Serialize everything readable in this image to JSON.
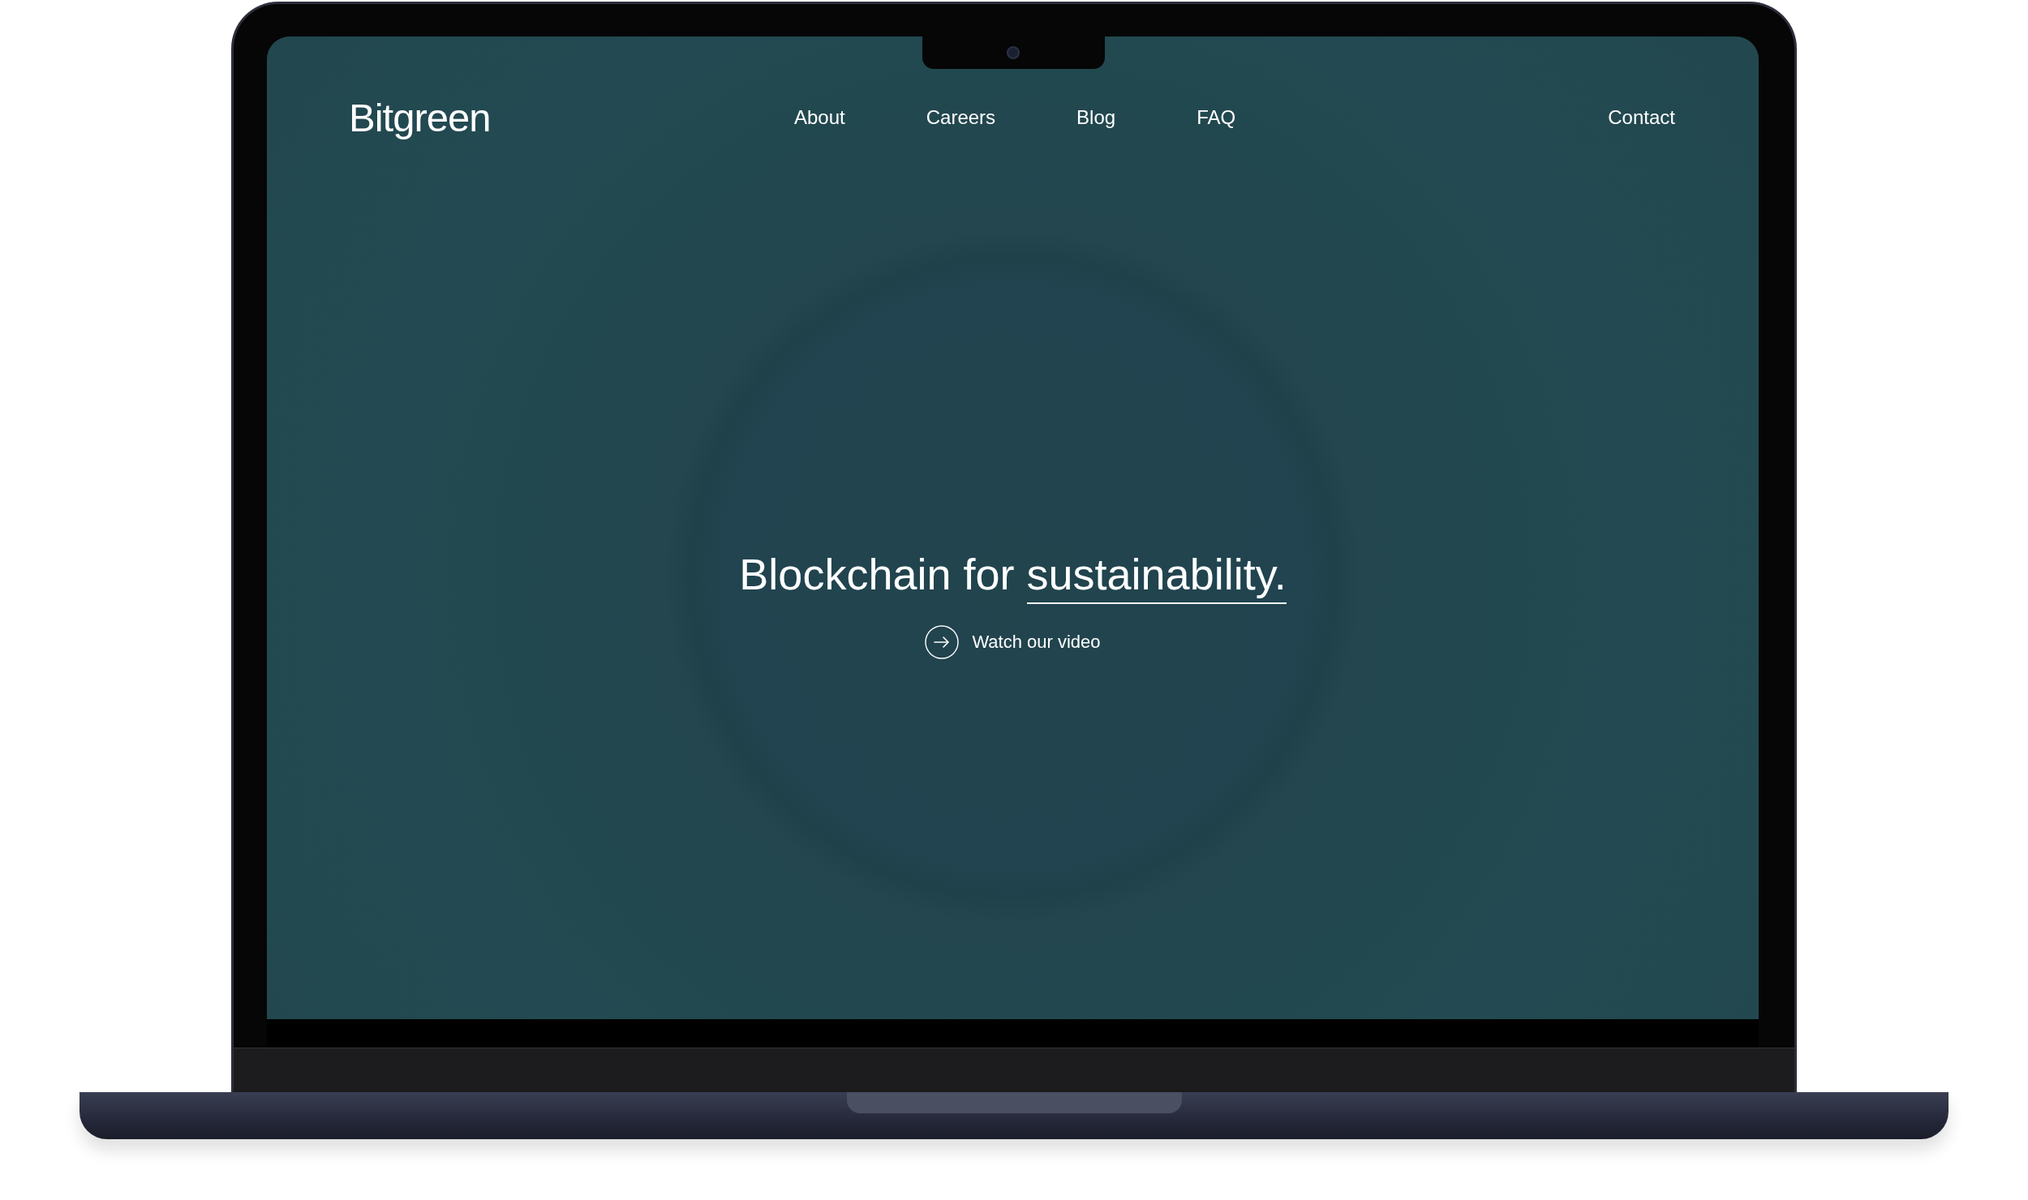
{
  "site": {
    "logo": "Bitgreen",
    "nav": [
      {
        "label": "About"
      },
      {
        "label": "Careers"
      },
      {
        "label": "Blog"
      },
      {
        "label": "FAQ"
      }
    ],
    "contact": "Contact"
  },
  "hero": {
    "headline_start": "Blockchain for",
    "headline_underlined": "sustainability.",
    "video_link": "Watch our video"
  }
}
